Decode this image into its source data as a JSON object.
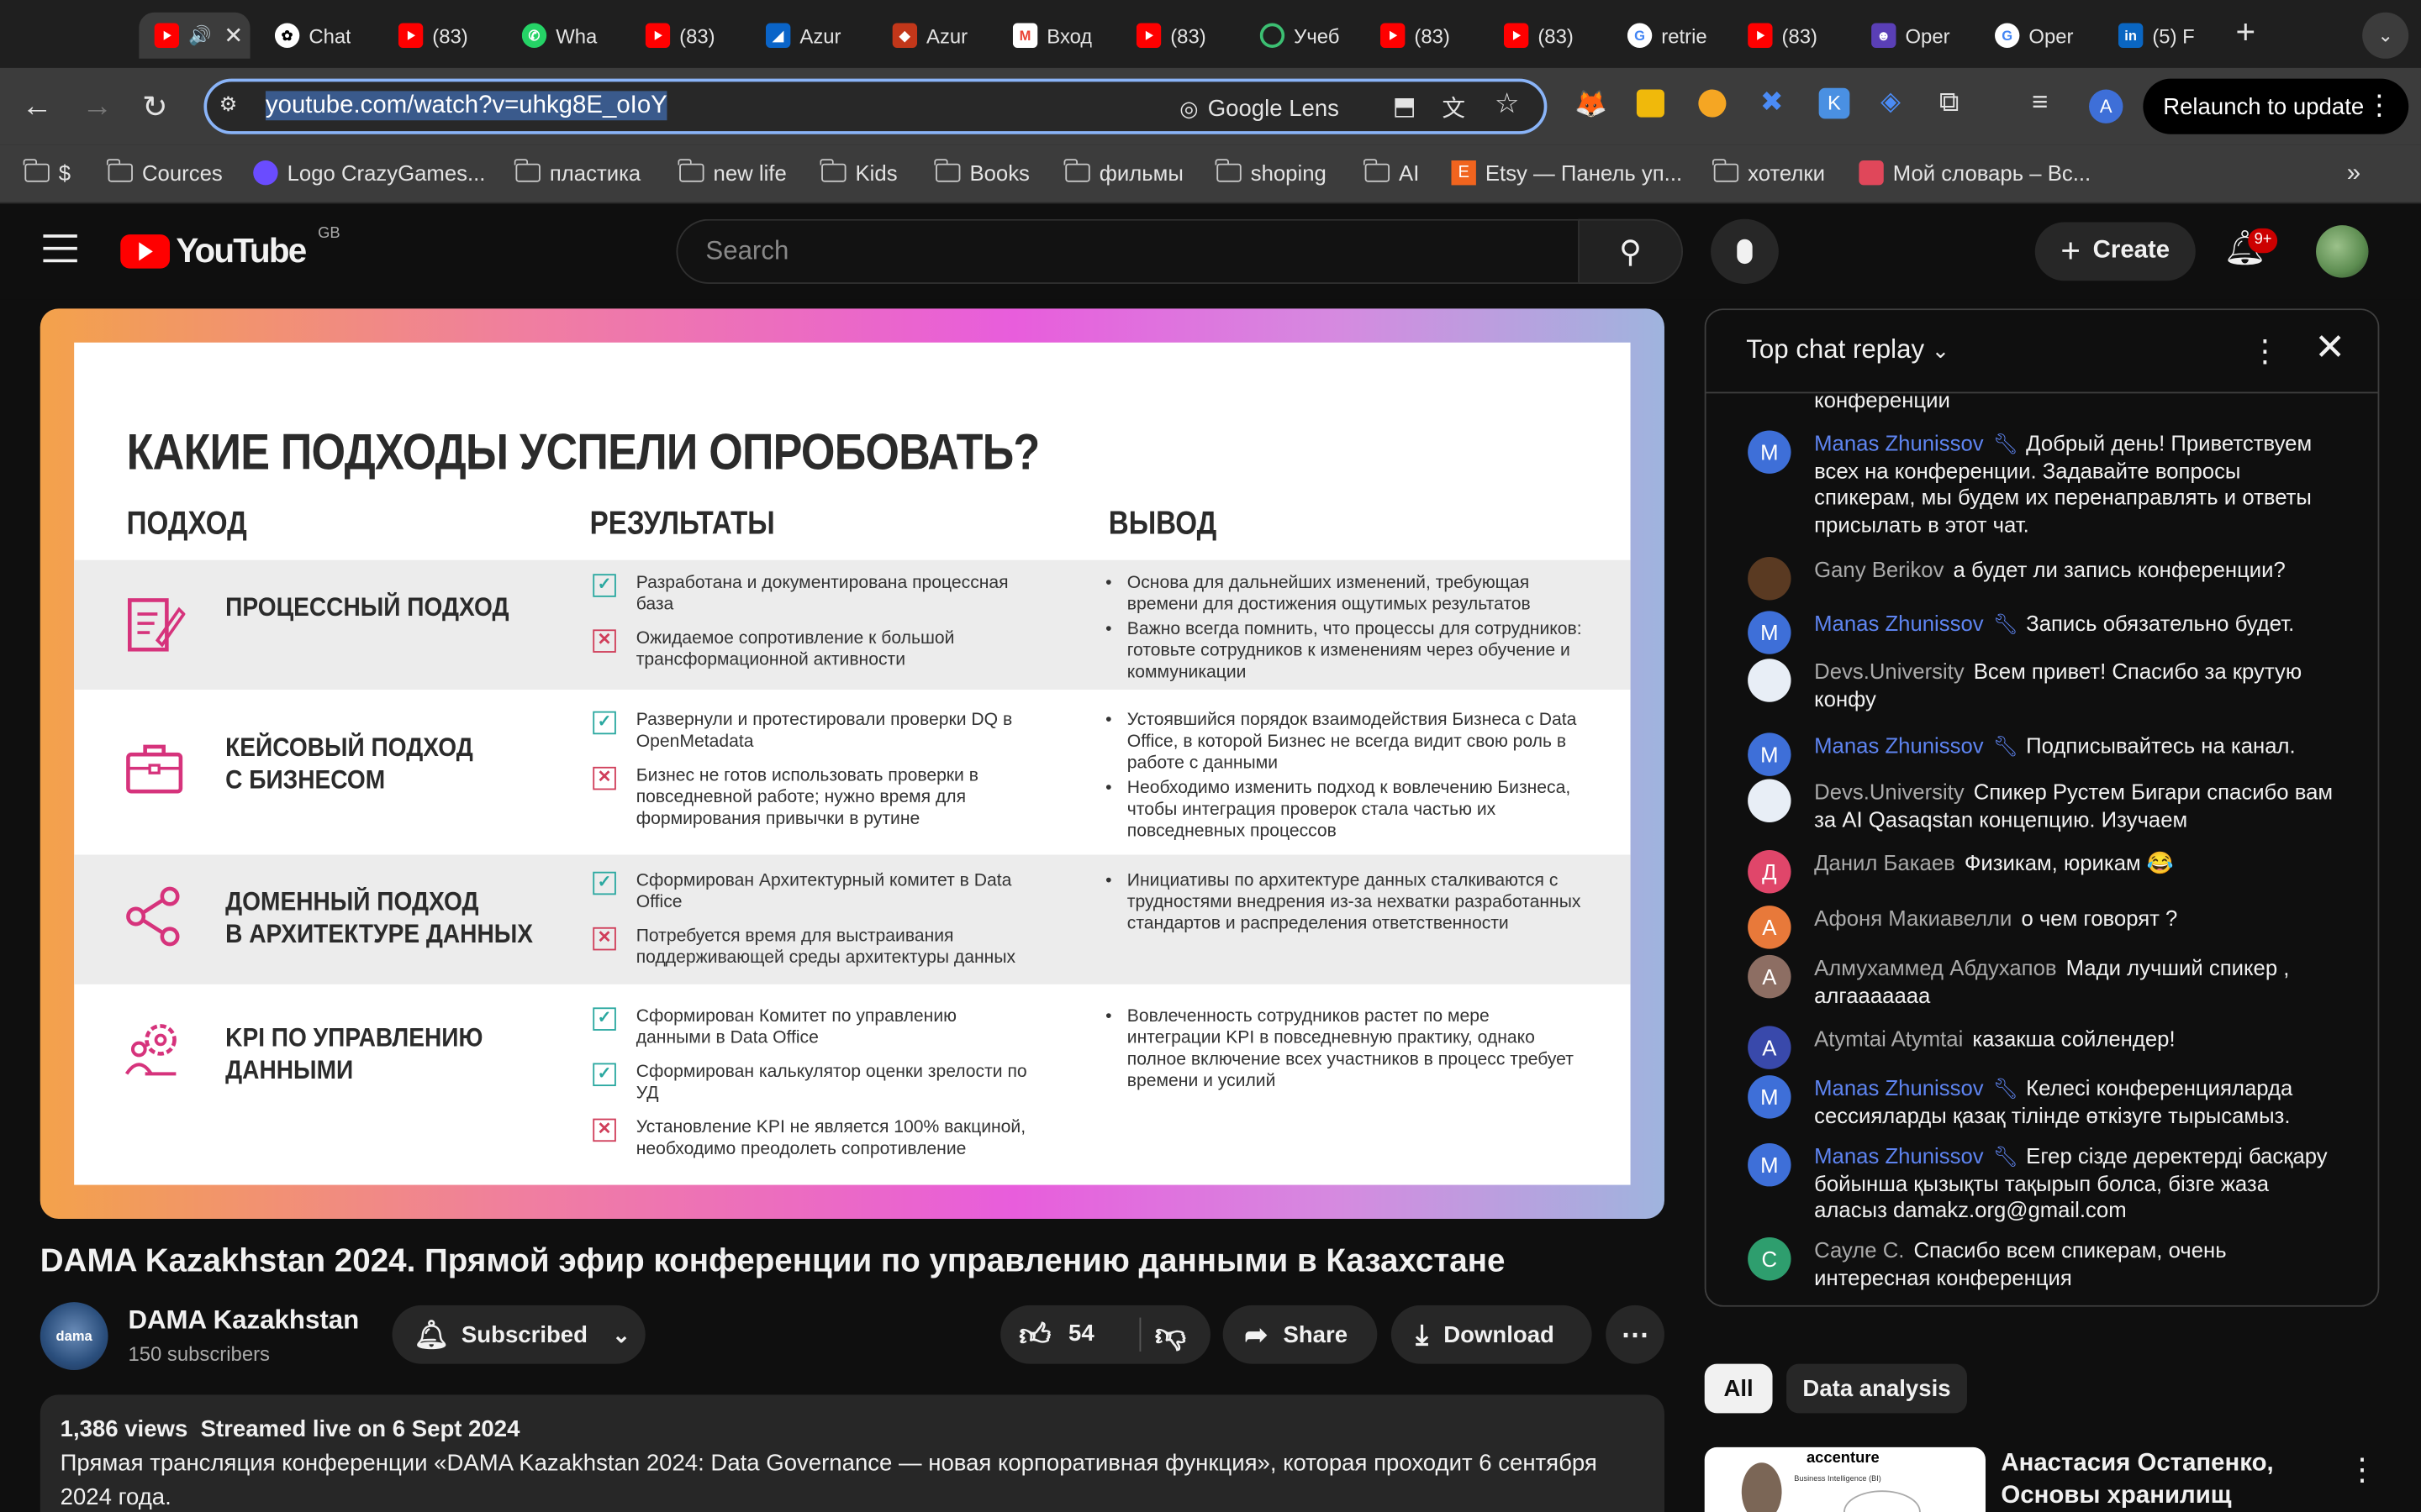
{
  "browser": {
    "tabs": [
      {
        "label": "",
        "favicon": "youtube",
        "active": true
      },
      {
        "label": "Chat",
        "favicon": "chatgpt"
      },
      {
        "label": "(83)",
        "favicon": "youtube"
      },
      {
        "label": "Wha",
        "favicon": "whatsapp"
      },
      {
        "label": "(83)",
        "favicon": "youtube"
      },
      {
        "label": "Azur",
        "favicon": "azure"
      },
      {
        "label": "Azur",
        "favicon": "azure-devops"
      },
      {
        "label": "Вход",
        "favicon": "gmail"
      },
      {
        "label": "(83)",
        "favicon": "youtube"
      },
      {
        "label": "Учеб",
        "favicon": "loop"
      },
      {
        "label": "(83)",
        "favicon": "youtube"
      },
      {
        "label": "(83)",
        "favicon": "youtube"
      },
      {
        "label": "retrie",
        "favicon": "google"
      },
      {
        "label": "(83)",
        "favicon": "youtube"
      },
      {
        "label": "Oper",
        "favicon": "openproject"
      },
      {
        "label": "Oper",
        "favicon": "google"
      },
      {
        "label": "(5) F",
        "favicon": "linkedin"
      }
    ],
    "url_host": "youtube.com",
    "url_path": "/watch?v=uhkg8E_oIoY",
    "lens_label": "Google Lens",
    "relaunch_label": "Relaunch to update",
    "bookmarks": [
      {
        "label": "$",
        "icon": "folder"
      },
      {
        "label": "Cources",
        "icon": "folder"
      },
      {
        "label": "Logo CrazyGames...",
        "icon": "crazygames"
      },
      {
        "label": "пластика",
        "icon": "folder"
      },
      {
        "label": "new life",
        "icon": "folder"
      },
      {
        "label": "Kids",
        "icon": "folder"
      },
      {
        "label": "Books",
        "icon": "folder"
      },
      {
        "label": "фильмы",
        "icon": "folder"
      },
      {
        "label": "shoping",
        "icon": "folder"
      },
      {
        "label": "AI",
        "icon": "folder"
      },
      {
        "label": "Etsy — Панель уп...",
        "icon": "etsy"
      },
      {
        "label": "хотелки",
        "icon": "folder"
      },
      {
        "label": "Мой словарь – Вс...",
        "icon": "dictionary"
      }
    ]
  },
  "youtube": {
    "logo_text": "YouTube",
    "region": "GB",
    "search_placeholder": "Search",
    "create_label": "Create",
    "notif_badge": "9+"
  },
  "slide": {
    "title": "КАКИЕ ПОДХОДЫ УСПЕЛИ ОПРОБОВАТЬ?",
    "col_approach": "ПОДХОД",
    "col_results": "РЕЗУЛЬТАТЫ",
    "col_conclusion": "ВЫВОД",
    "rows": [
      {
        "title": "ПРОЦЕССНЫЙ ПОДХОД",
        "icon": "document-pen-icon",
        "results": [
          {
            "ok": true,
            "text": "Разработана и документирована процессная база"
          },
          {
            "ok": false,
            "text": "Ожидаемое сопротивление к большой трансформационной активности"
          }
        ],
        "conclusions": [
          "Основа для дальнейших изменений, требующая времени для достижения ощутимых результатов",
          "Важно всегда помнить, что процессы для сотрудников: готовьте сотрудников к изменениям через обучение и коммуникации"
        ]
      },
      {
        "title": "КЕЙСОВЫЙ ПОДХОД\nС БИЗНЕСОМ",
        "icon": "briefcase-icon",
        "results": [
          {
            "ok": true,
            "text": "Развернули и протестировали проверки DQ в OpenMetadata"
          },
          {
            "ok": false,
            "text": "Бизнес не готов использовать проверки в повседневной работе; нужно время для формирования привычки в рутине"
          }
        ],
        "conclusions": [
          "Устоявшийся порядок взаимодействия Бизнеса с Data Office, в которой Бизнес не всегда видит свою роль в работе с данными",
          "Необходимо изменить подход к вовлечению Бизнеса, чтобы интеграция проверок стала частью их повседневных процессов"
        ]
      },
      {
        "title": "ДОМЕННЫЙ ПОДХОД\nВ АРХИТЕКТУРЕ ДАННЫХ",
        "icon": "share-nodes-icon",
        "results": [
          {
            "ok": true,
            "text": "Сформирован Архитектурный комитет в Data Office"
          },
          {
            "ok": false,
            "text": "Потребуется время для выстраивания поддерживающей среды архитектуры данных"
          }
        ],
        "conclusions": [
          "Инициативы по архитектуре данных сталкиваются с трудностями внедрения из-за нехватки разработанных стандартов и распределения ответственности"
        ]
      },
      {
        "title": "KPI ПО УПРАВЛЕНИЮ\nДАННЫМИ",
        "icon": "user-gear-icon",
        "results": [
          {
            "ok": true,
            "text": "Сформирован Комитет по управлению данными в Data Office"
          },
          {
            "ok": true,
            "text": "Сформирован калькулятор оценки зрелости по УД"
          },
          {
            "ok": false,
            "text": "Установление KPI не является 100% вакциной, необходимо преодолеть сопротивление"
          }
        ],
        "conclusions": [
          "Вовлеченность сотрудников растет по мере интеграции KPI в повседневную практику, однако полное включение всех участников в процесс требует времени и усилий"
        ]
      }
    ]
  },
  "video": {
    "title": "DAMA Kazakhstan 2024. Прямой эфир конференции по управлению данными в Казахстане",
    "channel_name": "DAMA Kazakhstan",
    "channel_avatar_text": "dama",
    "subscribers": "150 subscribers",
    "subscribed_label": "Subscribed",
    "likes": "54",
    "share_label": "Share",
    "download_label": "Download",
    "views": "1,386 views",
    "streamed": "Streamed live on 6 Sept 2024",
    "description": "Прямая трансляция конференции «DAMA Kazakhstan 2024: Data Governance — новая корпоративная функция», которая проходит 6 сентября 2024 года."
  },
  "chat": {
    "header": "Top chat replay",
    "partial_top": "конференции",
    "messages": [
      {
        "author": "Manas Zhunissov",
        "mod": true,
        "avatar": "M",
        "avatar_color": "#3e6fd8",
        "text": "Добрый день! Приветствуем всех на конференции. Задавайте вопросы спикерам, мы будем их перенаправлять и ответы присылать в этот чат."
      },
      {
        "author": "Gany Berikov",
        "mod": false,
        "avatar": "",
        "avatar_color": "#5a3a22",
        "text": "а будет ли запись конференции?"
      },
      {
        "author": "Manas Zhunissov",
        "mod": true,
        "avatar": "M",
        "avatar_color": "#3e6fd8",
        "text": "Запись обязательно будет."
      },
      {
        "author": "Devs.University",
        "mod": false,
        "avatar": "",
        "avatar_color": "#e8eef6",
        "text": "Всем привет! Спасибо за крутую конфу"
      },
      {
        "author": "Manas Zhunissov",
        "mod": true,
        "avatar": "M",
        "avatar_color": "#3e6fd8",
        "text": "Подписывайтесь на канал."
      },
      {
        "author": "Devs.University",
        "mod": false,
        "avatar": "",
        "avatar_color": "#e8eef6",
        "text": "Спикер Рустем Бигари спасибо вам за AI Qasaqstan концепцию. Изучаем"
      },
      {
        "author": "Данил Бакаев",
        "mod": false,
        "avatar": "Д",
        "avatar_color": "#e0466a",
        "text": "Физикам, юрикам 😂"
      },
      {
        "author": "Афоня Макиавелли",
        "mod": false,
        "avatar": "А",
        "avatar_color": "#e8793a",
        "text": "о чем говорят ?"
      },
      {
        "author": "Алмухаммед Абдухапов",
        "mod": false,
        "avatar": "А",
        "avatar_color": "#8d6e63",
        "text": "Мади лучший спикер , алгааааааа"
      },
      {
        "author": "Atymtai Atymtai",
        "mod": false,
        "avatar": "A",
        "avatar_color": "#3949ab",
        "text": "казакша сойлендер!"
      },
      {
        "author": "Manas Zhunissov",
        "mod": true,
        "avatar": "M",
        "avatar_color": "#3e6fd8",
        "text": "Келесі конференцияларда сессияларды қазақ тілінде өткізуге тырысамыз."
      },
      {
        "author": "Manas Zhunissov",
        "mod": true,
        "avatar": "M",
        "avatar_color": "#3e6fd8",
        "text": "Егер сізде деректерді басқару бойынша қызықты тақырып болса, бізге жаза аласыз damakz.org@gmail.com"
      },
      {
        "author": "Сауле С.",
        "mod": false,
        "avatar": "С",
        "avatar_color": "#2e9e6e",
        "text": "Спасибо всем спикерам, очень интересная конференция"
      }
    ]
  },
  "sidebar": {
    "chips": [
      "All",
      "Data analysis"
    ],
    "rec_title": "Анастасия Остапенко, Основы хранилищ данных....",
    "rec_thumb_brand": "accenture",
    "rec_thumb_caption": "Business Intelligence (BI)"
  }
}
